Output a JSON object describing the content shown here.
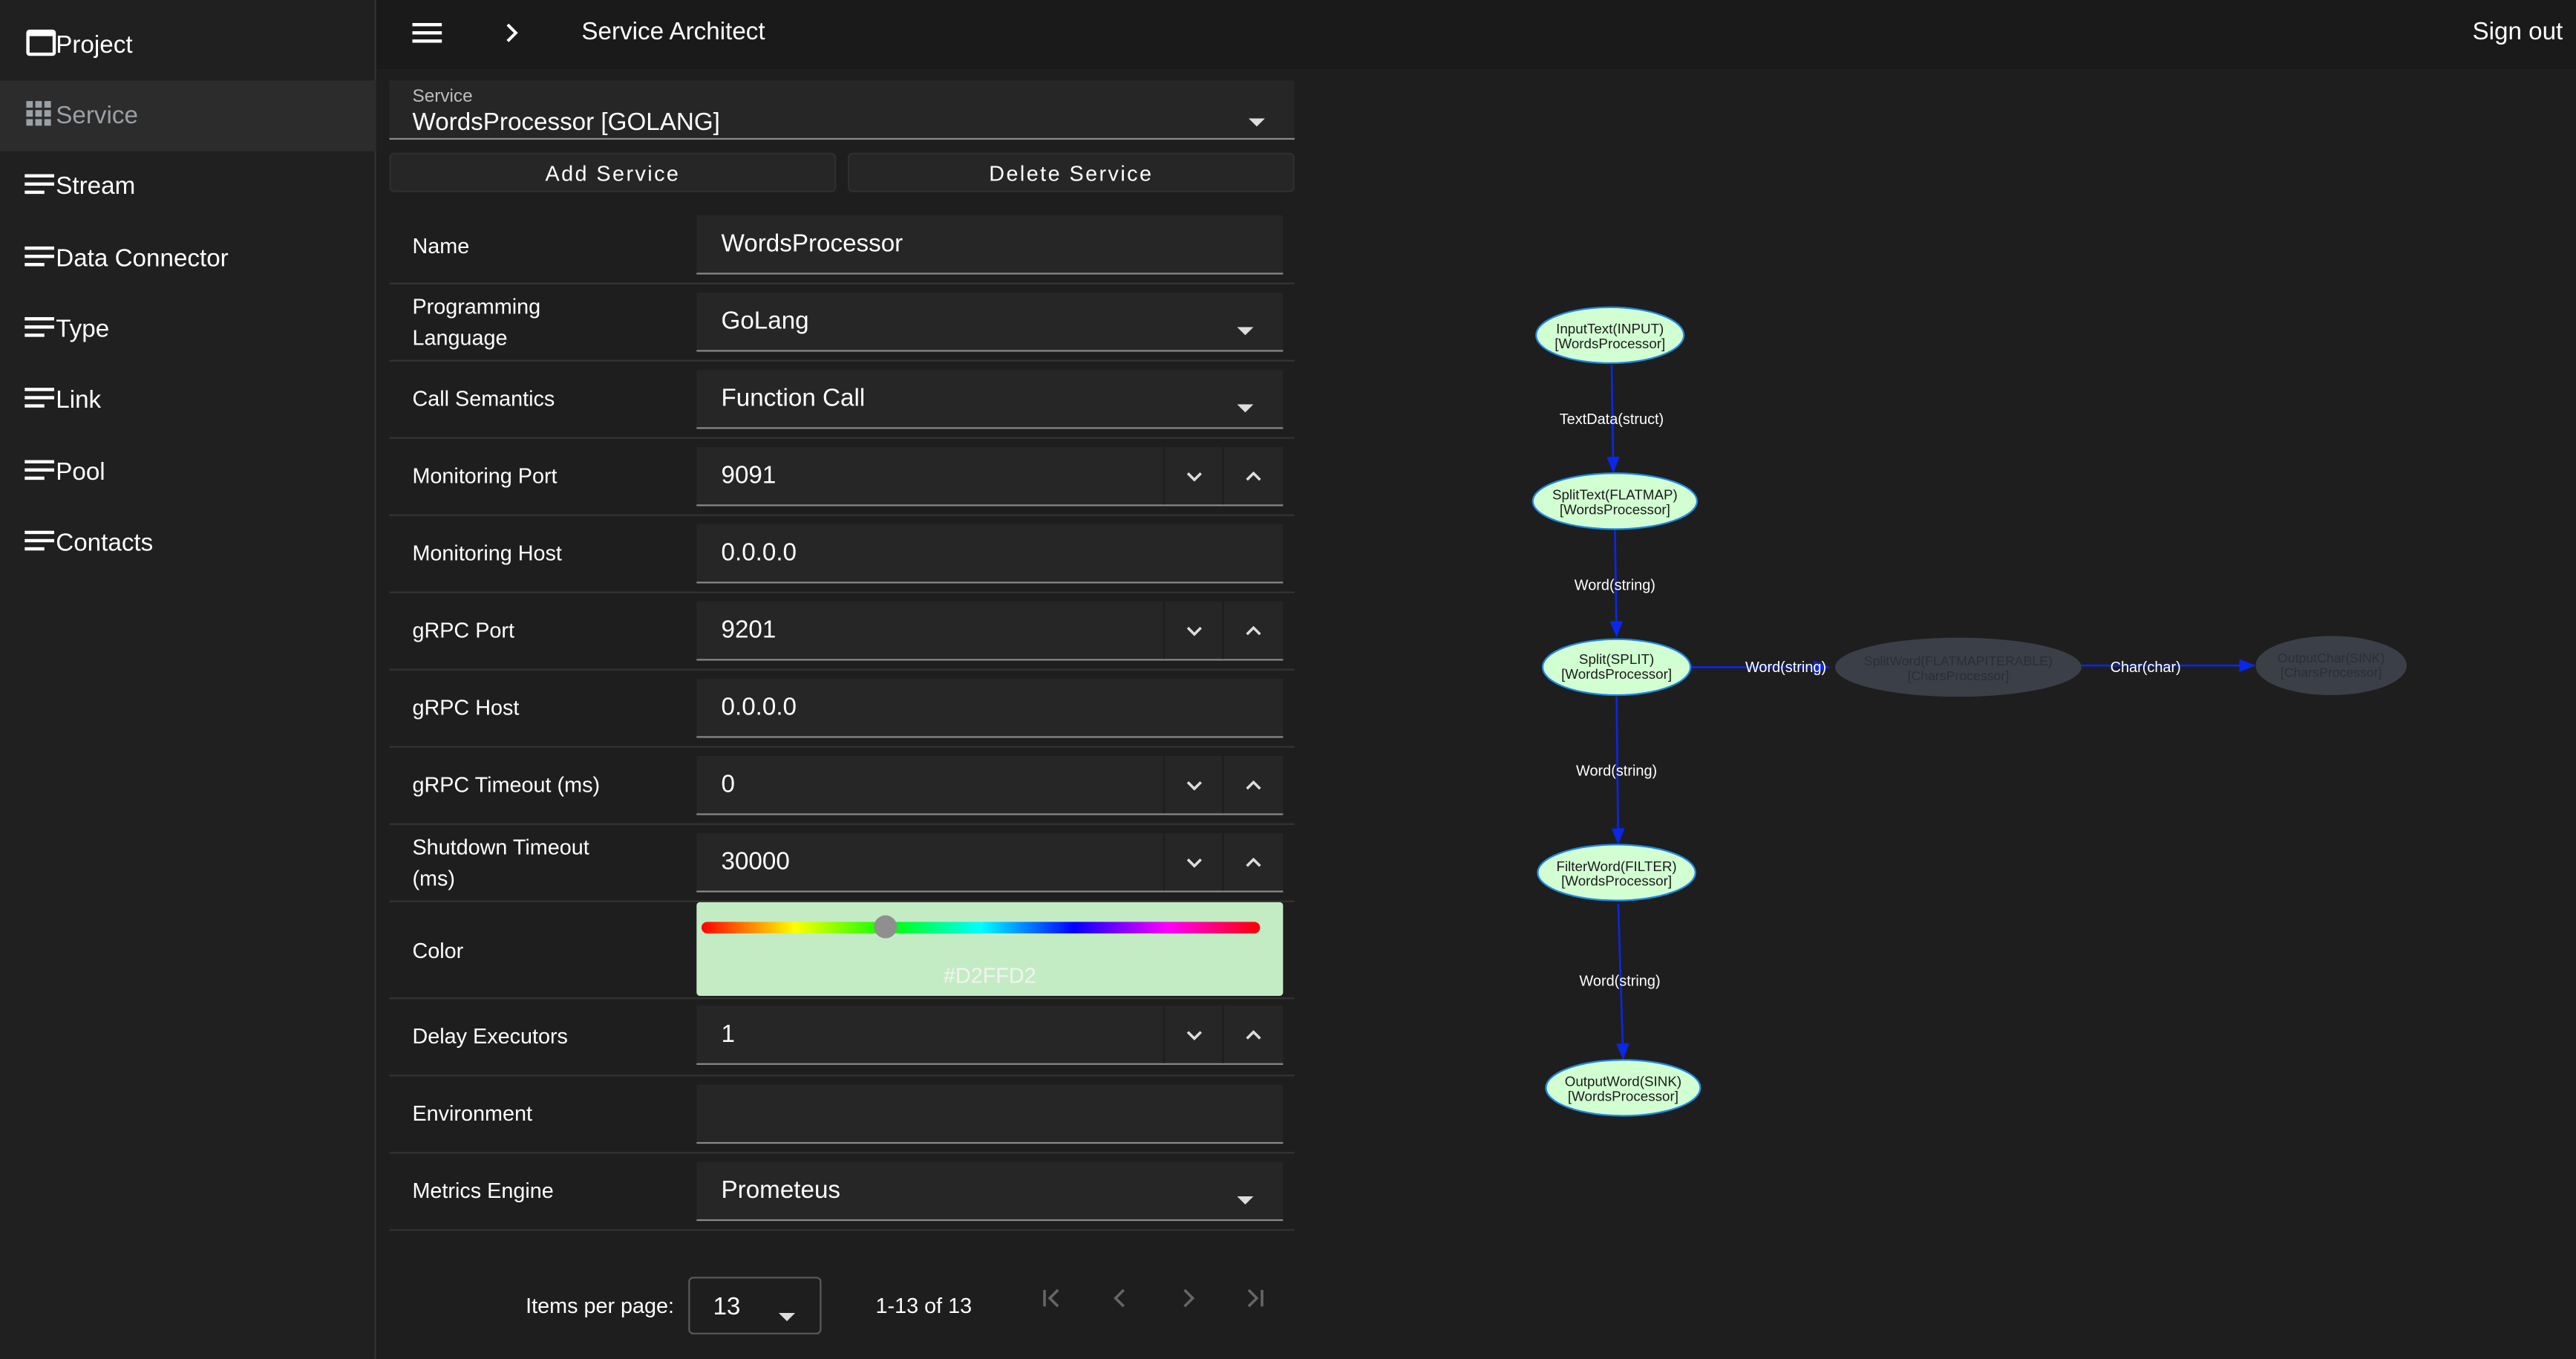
{
  "colors": {
    "node_fill": "#D2FFD2",
    "node_fill_dim": "#3a3f48",
    "edge": "#0b27e8",
    "accent_selected_color": "#D2FFD2"
  },
  "sidebar": {
    "items": [
      {
        "label": "Project",
        "icon": "window-icon"
      },
      {
        "label": "Service",
        "icon": "grid-icon",
        "active": true
      },
      {
        "label": "Stream",
        "icon": "list-icon"
      },
      {
        "label": "Data Connector",
        "icon": "list-icon"
      },
      {
        "label": "Type",
        "icon": "list-icon"
      },
      {
        "label": "Link",
        "icon": "list-icon"
      },
      {
        "label": "Pool",
        "icon": "list-icon"
      },
      {
        "label": "Contacts",
        "icon": "list-icon"
      }
    ]
  },
  "topbar": {
    "title": "Service Architect",
    "signout": "Sign out"
  },
  "service_select": {
    "label": "Service",
    "value": "WordsProcessor [GOLANG]"
  },
  "buttons": {
    "add": "Add Service",
    "delete": "Delete Service"
  },
  "form": {
    "name": {
      "label": "Name",
      "value": "WordsProcessor"
    },
    "language": {
      "label1": "Programming",
      "label2": "Language",
      "value": "GoLang"
    },
    "call_semantics": {
      "label": "Call Semantics",
      "value": "Function Call"
    },
    "monitoring_port": {
      "label": "Monitoring Port",
      "value": "9091"
    },
    "monitoring_host": {
      "label": "Monitoring Host",
      "value": "0.0.0.0"
    },
    "grpc_port": {
      "label": "gRPC Port",
      "value": "9201"
    },
    "grpc_host": {
      "label": "gRPC Host",
      "value": "0.0.0.0"
    },
    "grpc_timeout": {
      "label": "gRPC Timeout (ms)",
      "value": "0"
    },
    "shutdown_timeout": {
      "label1": "Shutdown Timeout",
      "label2": "(ms)",
      "value": "30000"
    },
    "color": {
      "label": "Color",
      "value": "#D2FFD2",
      "hue_position": 0.33
    },
    "delay_executors": {
      "label": "Delay Executors",
      "value": "1"
    },
    "environment": {
      "label": "Environment",
      "value": ""
    },
    "metrics_engine": {
      "label": "Metrics Engine",
      "value": "Prometeus"
    }
  },
  "pager": {
    "items_per_page_label": "Items per page:",
    "items_per_page": "13",
    "range": "1-13 of 13"
  },
  "graph": {
    "nodes": [
      {
        "name": "InputText(INPUT)",
        "owner": "[WordsProcessor]"
      },
      {
        "name": "SplitText(FLATMAP)",
        "owner": "[WordsProcessor]"
      },
      {
        "name": "Split(SPLIT)",
        "owner": "[WordsProcessor]"
      },
      {
        "name": "FilterWord(FILTER)",
        "owner": "[WordsProcessor]"
      },
      {
        "name": "OutputWord(SINK)",
        "owner": "[WordsProcessor]"
      },
      {
        "name": "SplitWord(FLATMAPITERABLE)",
        "owner": "[CharsProcessor]"
      },
      {
        "name": "OutputChar(SINK)",
        "owner": "[CharsProcessor]"
      }
    ],
    "edges": [
      {
        "label": "TextData(struct)"
      },
      {
        "label": "Word(string)"
      },
      {
        "label": "Word(string)"
      },
      {
        "label": "Word(string)"
      },
      {
        "label": "Word(string)"
      },
      {
        "label": "Char(char)"
      }
    ]
  }
}
